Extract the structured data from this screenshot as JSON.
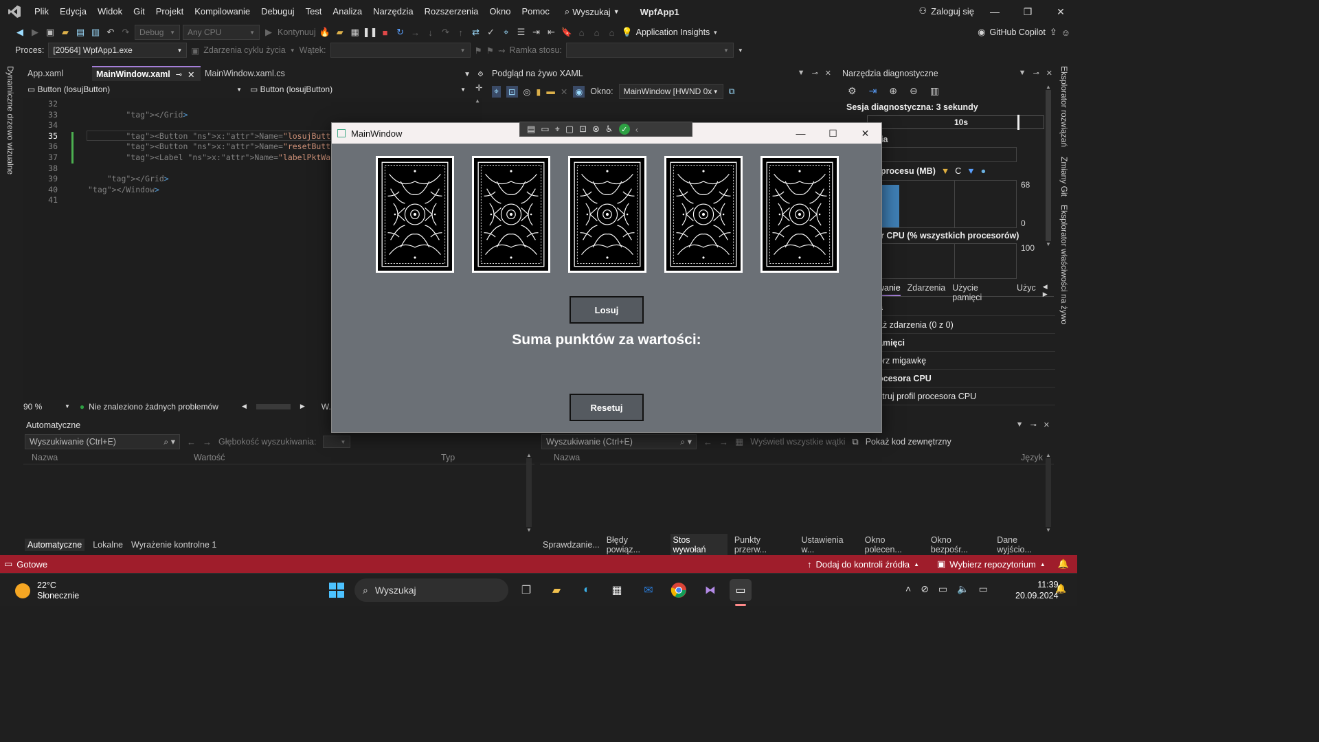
{
  "menu": [
    "Plik",
    "Edycja",
    "Widok",
    "Git",
    "Projekt",
    "Kompilowanie",
    "Debuguj",
    "Test",
    "Analiza",
    "Narzędzia",
    "Rozszerzenia",
    "Okno",
    "Pomoc"
  ],
  "search_label": "Wyszukaj",
  "app_name": "WpfApp1",
  "signin_label": "Zaloguj się",
  "toolbar": {
    "config": "Debug",
    "platform": "Any CPU",
    "continue_label": "Kontynuuj",
    "app_insights": "Application Insights",
    "copilot": "GitHub Copilot"
  },
  "toolbar2": {
    "process_label": "Proces:",
    "process_value": "[20564] WpfApp1.exe",
    "lifecycle_label": "Zdarzenia cyklu życia",
    "thread_label": "Wątek:",
    "frame_label": "Ramka stosu:"
  },
  "editor": {
    "tabs": [
      "App.xaml",
      "MainWindow.xaml",
      "MainWindow.xaml.cs"
    ],
    "nav_left": "Button (losujButton)",
    "nav_right": "Button (losujButton)",
    "lines": [
      {
        "n": "32",
        "code": ""
      },
      {
        "n": "33",
        "code": "        </Grid>"
      },
      {
        "n": "34",
        "code": ""
      },
      {
        "n": "35",
        "code": "        <Button x:Name=\"losujButton\" Background=\"#"
      },
      {
        "n": "36",
        "code": "        <Button x:Name=\"resetButton\" Background=\"#"
      },
      {
        "n": "37",
        "code": "        <Label x:Name=\"labelPktWartosci\" Content=\"S"
      },
      {
        "n": "38",
        "code": ""
      },
      {
        "n": "39",
        "code": "    </Grid>"
      },
      {
        "n": "40",
        "code": "</Window>"
      },
      {
        "n": "41",
        "code": ""
      }
    ],
    "zoom": "90 %",
    "problems": "Nie znaleziono żadnych problemów",
    "cursor": "W.: 35"
  },
  "side_left": "Dynamiczne drzewo wizualne",
  "side_right": [
    "Eksplorator rozwiązań",
    "Zmiany Git",
    "Eksplorator właściwości na żywo"
  ],
  "live_xaml": {
    "title": "Podgląd na żywo XAML",
    "window_label": "Okno:",
    "window_value": "MainWindow [HWND 0x"
  },
  "diag": {
    "title": "Narzędzia diagnostyczne",
    "session": "Sesja diagnostyczna: 3 sekundy",
    "tick": "10s",
    "events_frag": "ia",
    "mem_title": "procesu (MB)",
    "mem_legend": "C",
    "mem_max": "68",
    "mem_min": "0",
    "cpu_title": "r CPU (% wszystkich procesorów)",
    "cpu_max": "100",
    "tabs": [
      "wanie",
      "Zdarzenia",
      "Użycie pamięci",
      "Użyc"
    ],
    "rows": [
      "a",
      "aż zdarzenia (0 z 0)",
      "amięci",
      "órz migawkę",
      "ocesora CPU",
      "struj profil procesora CPU"
    ]
  },
  "autos": {
    "title": "Automatyczne",
    "search": "Wyszukiwanie (Ctrl+E)",
    "depth_label": "Głębokość wyszukiwania:",
    "cols": [
      "Nazwa",
      "Wartość",
      "Typ"
    ],
    "tabs": [
      "Automatyczne",
      "Lokalne",
      "Wyrażenie kontrolne 1"
    ]
  },
  "callstack": {
    "search": "Wyszukiwanie (Ctrl+E)",
    "threads_label": "Wyświetl wszystkie wątki",
    "external_label": "Pokaż kod zewnętrzny",
    "cols": [
      "Nazwa",
      "Język"
    ],
    "tabs": [
      "Sprawdzanie...",
      "Błędy powiąz...",
      "Stos wywołań",
      "Punkty przerw...",
      "Ustawienia w...",
      "Okno polecen...",
      "Okno bezpośr...",
      "Dane wyjścio..."
    ]
  },
  "statusbar": {
    "ready": "Gotowe",
    "source_control": "Dodaj do kontroli źródła",
    "repo": "Wybierz repozytorium",
    "color": "#9f1d2b"
  },
  "taskbar": {
    "temp": "22°C",
    "weather": "Słonecznie",
    "search": "Wyszukaj",
    "time": "11:39",
    "date": "20.09.2024"
  },
  "wpf": {
    "title": "MainWindow",
    "losuj": "Losuj",
    "suma": "Suma punktów za wartości:",
    "reset": "Resetuj",
    "card_count": 5,
    "bg": "#6b7076"
  }
}
